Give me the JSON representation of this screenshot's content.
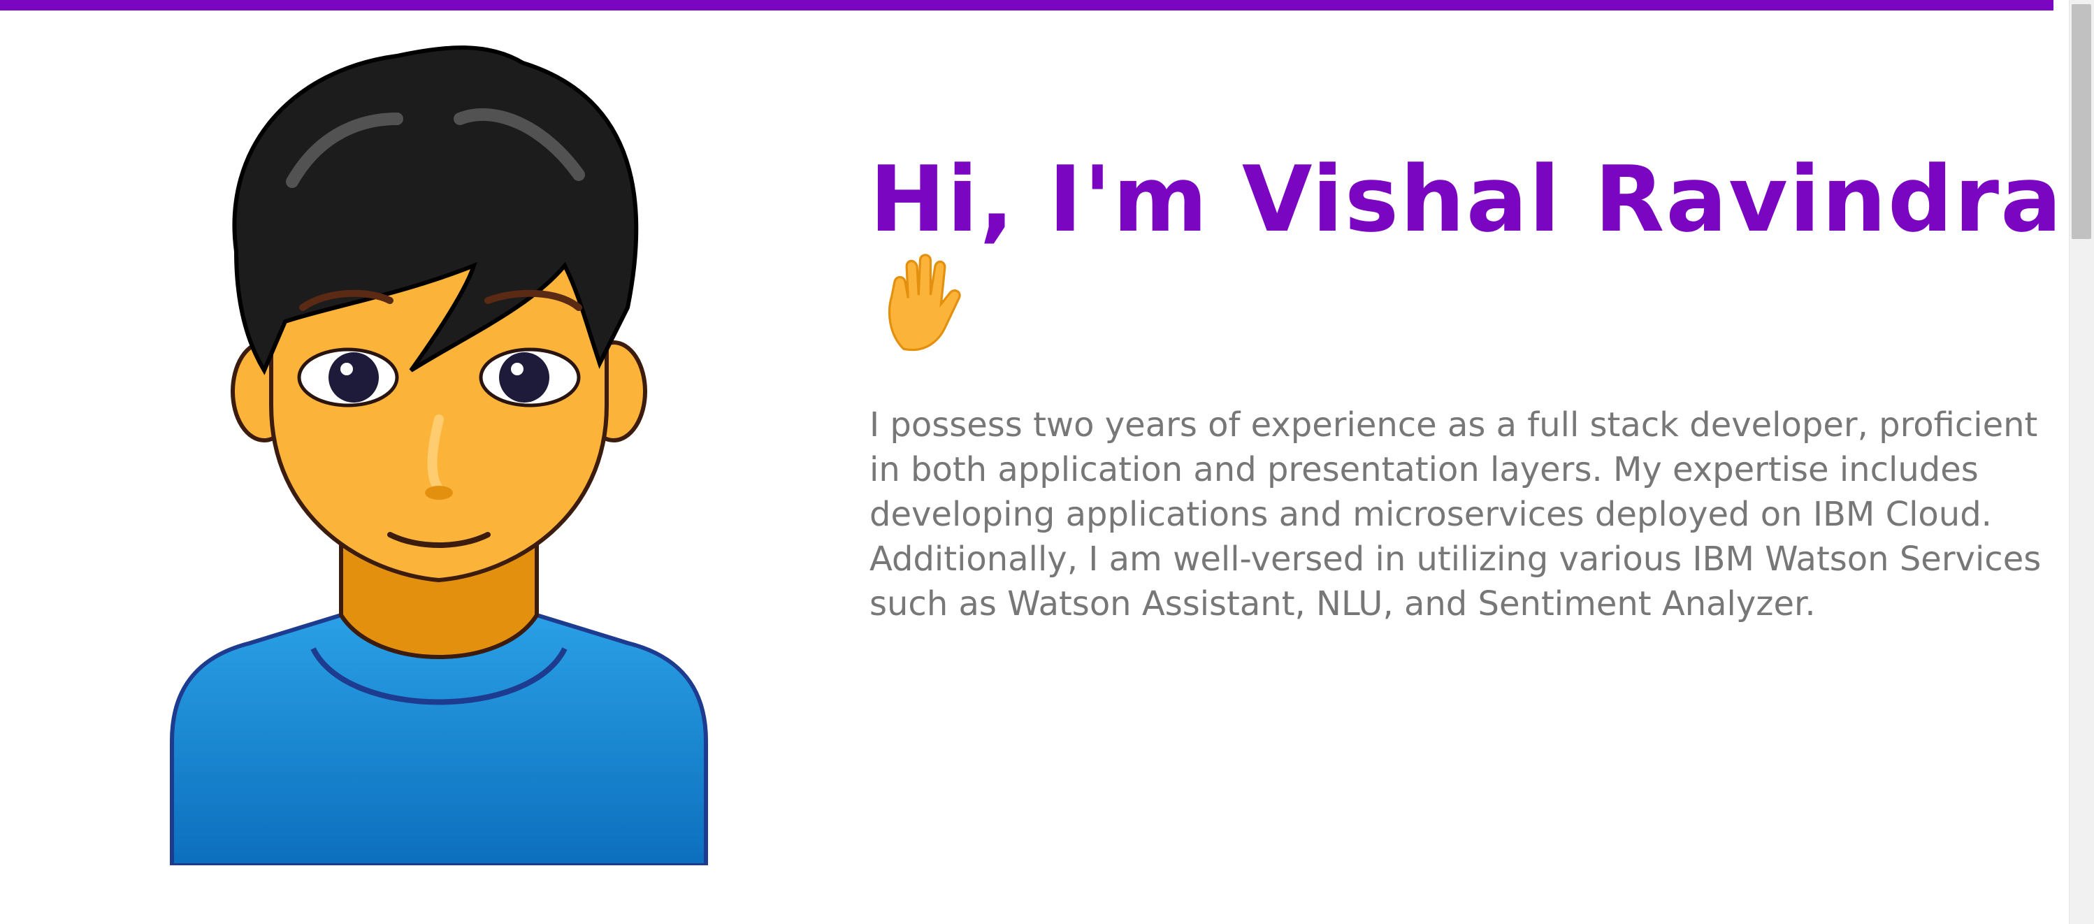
{
  "theme": {
    "accent": "#7a06c2",
    "body_text": "#777777",
    "skin": "#fbb33a",
    "shirt": "#1a8bd6",
    "hair": "#1c1c1c"
  },
  "hero": {
    "avatar_icon": "man-technologist-emoji",
    "heading": "Hi, I'm Vishal Ravindran!",
    "wave_icon": "raised-hand-emoji",
    "bio": "I possess two years of experience as a full stack developer, proficient in both application and presentation layers. My expertise includes developing applications and microservices deployed on IBM Cloud. Additionally, I am well-versed in utilizing various IBM Watson Services such as Watson Assistant, NLU, and Sentiment Analyzer."
  }
}
